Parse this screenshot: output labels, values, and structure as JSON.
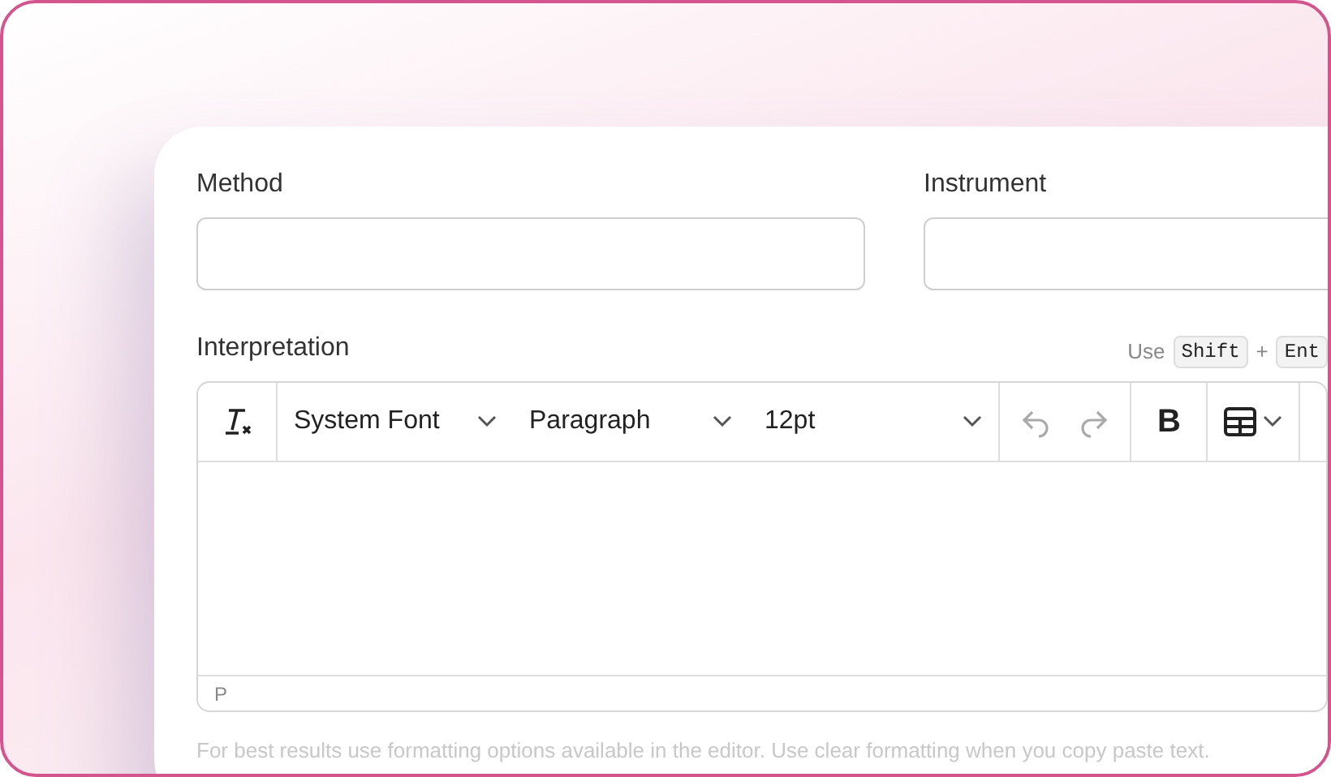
{
  "fields": [
    {
      "label": "Method"
    },
    {
      "label": "Instrument"
    }
  ],
  "editor": {
    "label": "Interpretation",
    "hint": {
      "prefix": "Use",
      "keys": [
        "Shift",
        "Ent"
      ],
      "joiner": "+"
    },
    "toolbar": [
      {
        "kind": "clear-format",
        "disabled": false
      },
      {
        "kind": "select",
        "label": "System Font"
      },
      {
        "kind": "select",
        "label": "Paragraph"
      },
      {
        "kind": "select",
        "label": "12pt"
      },
      {
        "kind": "undo",
        "disabled": true
      },
      {
        "kind": "redo",
        "disabled": true
      },
      {
        "kind": "bold",
        "label": "B",
        "disabled": false
      },
      {
        "kind": "table",
        "disabled": false
      }
    ],
    "status_path": "P",
    "help": "For best results use formatting options available in the editor. Use clear formatting when you copy paste text."
  }
}
